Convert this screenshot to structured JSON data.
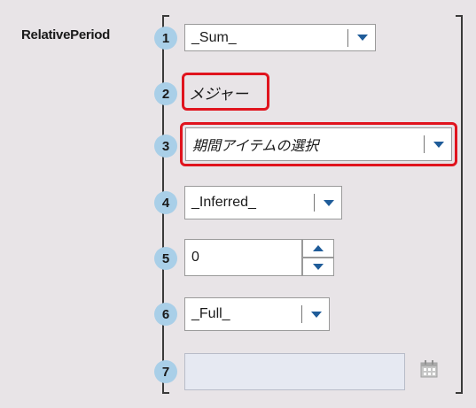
{
  "title": "RelativePeriod",
  "rows": [
    {
      "num": "1",
      "value": "_Sum_"
    },
    {
      "num": "2",
      "value": "メジャー"
    },
    {
      "num": "3",
      "value": "期間アイテムの選択"
    },
    {
      "num": "4",
      "value": "_Inferred_"
    },
    {
      "num": "5",
      "value": "0"
    },
    {
      "num": "6",
      "value": "_Full_"
    },
    {
      "num": "7",
      "value": ""
    }
  ],
  "colors": {
    "highlight": "#e0141e",
    "badge": "#a9cfe8",
    "arrow": "#1f5c99"
  },
  "icons": [
    "chevron-down-icon",
    "chevron-up-icon",
    "calendar-icon"
  ]
}
